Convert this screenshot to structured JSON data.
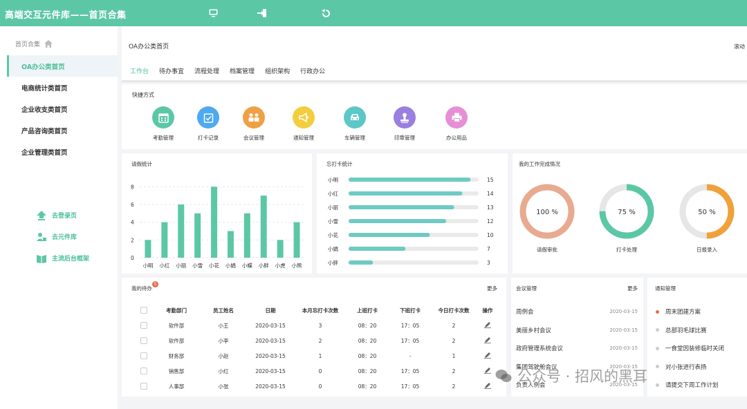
{
  "header": {
    "title": "高端交互元件库——首页合集"
  },
  "sidebar": {
    "crumb": "首页合集",
    "items": [
      {
        "label": "OA办公类首页",
        "active": true
      },
      {
        "label": "电商统计类首页"
      },
      {
        "label": "企业收支类首页"
      },
      {
        "label": "产品咨询类首页"
      },
      {
        "label": "企业管理类首页"
      }
    ],
    "links": [
      {
        "label": "去登录页"
      },
      {
        "label": "去元件库"
      },
      {
        "label": "主流后台框架"
      }
    ]
  },
  "page": {
    "title": "OA办公类首页",
    "scroll_hint": "滚动"
  },
  "tabs": [
    "工作台",
    "待办事宜",
    "流程处理",
    "档案管理",
    "组织架构",
    "行政办公"
  ],
  "quick": {
    "label": "快捷方式",
    "items": [
      {
        "label": "考勤管理",
        "color": "#5cc7a5",
        "icon": "calendar-icon"
      },
      {
        "label": "打卡记录",
        "color": "#4da9f0",
        "icon": "checklist-icon"
      },
      {
        "label": "会议管理",
        "color": "#f0a044",
        "icon": "people-icon"
      },
      {
        "label": "通知管理",
        "color": "#f3cd3d",
        "icon": "megaphone-icon"
      },
      {
        "label": "车辆管理",
        "color": "#5cc7c7",
        "icon": "car-icon"
      },
      {
        "label": "印章管理",
        "color": "#9a7fe0",
        "icon": "stamp-icon"
      },
      {
        "label": "办公用品",
        "color": "#e68fd5",
        "icon": "printer-icon"
      }
    ]
  },
  "leave": {
    "title": "请假统计",
    "chart_data": {
      "type": "bar",
      "categories": [
        "小明",
        "小红",
        "小丽",
        "小雪",
        "小花",
        "小娟",
        "小蝶",
        "小胖",
        "小虎",
        "小熊"
      ],
      "values": [
        2,
        4,
        6,
        5,
        8,
        3,
        5,
        7,
        2,
        4
      ],
      "yticks": [
        0,
        2,
        4,
        6,
        8
      ],
      "ylim": [
        0,
        8.8
      ],
      "color": "#5cc7a5"
    }
  },
  "forgot": {
    "title": "忘打卡统计",
    "chart_data": {
      "type": "bar",
      "orientation": "horizontal",
      "categories": [
        "小明",
        "小红",
        "小丽",
        "小雪",
        "小花",
        "小娟",
        "小胖"
      ],
      "values": [
        15,
        14,
        13,
        12,
        10,
        7,
        3
      ],
      "xlim": [
        0,
        16
      ],
      "color": "#6ecac4"
    }
  },
  "work": {
    "title": "我的工作完成情况",
    "chart_data": {
      "type": "pie",
      "items": [
        {
          "label": "请假审批",
          "value": 100,
          "text": "100 %",
          "color": "#e8ab90"
        },
        {
          "label": "打卡处理",
          "value": 75,
          "text": "75 %",
          "color": "#5cc7a5"
        },
        {
          "label": "日报录入",
          "value": 50,
          "text": "50 %",
          "color": "#f0a13a"
        }
      ]
    }
  },
  "todo": {
    "title": "我的待办",
    "badge": "5",
    "more": "更多",
    "headers": [
      "考勤部门",
      "员工姓名",
      "日期",
      "本月忘打卡次数",
      "上班打卡",
      "下班打卡",
      "今日打卡次数",
      "操作"
    ],
    "rows": [
      [
        "软件部",
        "小王",
        "2020-03-15",
        "3",
        "08：20",
        "17：05",
        "2"
      ],
      [
        "软件部",
        "小李",
        "2020-03-15",
        "2",
        "08：20",
        "17：05",
        "2"
      ],
      [
        "财务部",
        "小赵",
        "2020-03-15",
        "1",
        "08：20",
        "-",
        "1"
      ],
      [
        "销售部",
        "小红",
        "2020-03-15",
        "0",
        "08：20",
        "17：05",
        "2"
      ],
      [
        "人事部",
        "小张",
        "2020-03-15",
        "0",
        "08：20",
        "17：05",
        "2"
      ]
    ]
  },
  "meetings": {
    "title": "会议管理",
    "more": "更多",
    "rows": [
      {
        "name": "周例会",
        "date": "2020-03-15"
      },
      {
        "name": "美丽乡村会议",
        "date": "2020-03-15"
      },
      {
        "name": "政府管理系统会议",
        "date": "2020-03-15"
      },
      {
        "name": "集团驾驶舱会议",
        "date": "2020-03-15"
      },
      {
        "name": "负责人例会",
        "date": "2020-03-15"
      }
    ]
  },
  "notices": {
    "title": "通知管理",
    "rows": [
      {
        "name": "周末团建方案",
        "hot": true
      },
      {
        "name": "总部羽毛球比赛"
      },
      {
        "name": "一食堂因装修临时关闭"
      },
      {
        "name": "对小张进行表扬"
      },
      {
        "name": "请提交下周工作计划"
      }
    ]
  },
  "watermark": "公众号 · 招风的黑耳"
}
